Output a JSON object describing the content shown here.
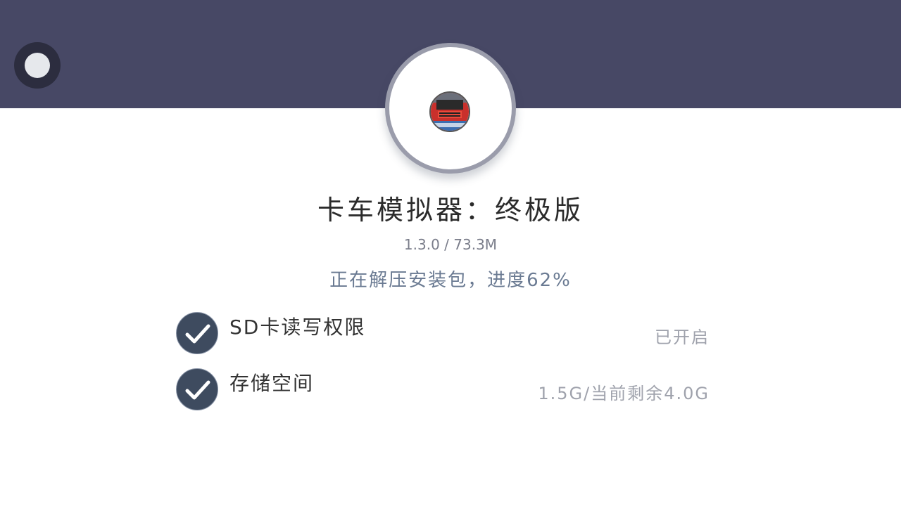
{
  "app": {
    "title": "卡车模拟器：终极版",
    "version_size": "1.3.0 / 73.3M",
    "status": "正在解压安装包，进度62%",
    "install_progress_percent": 62
  },
  "permissions": [
    {
      "label": "SD卡读写权限",
      "status": "已开启"
    },
    {
      "label": "存储空间",
      "status": "1.5G/当前剩余4.0G"
    }
  ],
  "colors": {
    "header_band": "#474865",
    "check_fill": "#3e4b5f",
    "status_text": "#6a7a92"
  },
  "icons": {
    "back": "back-circle-icon",
    "app": "truck-app-icon",
    "check": "checkmark-icon"
  }
}
